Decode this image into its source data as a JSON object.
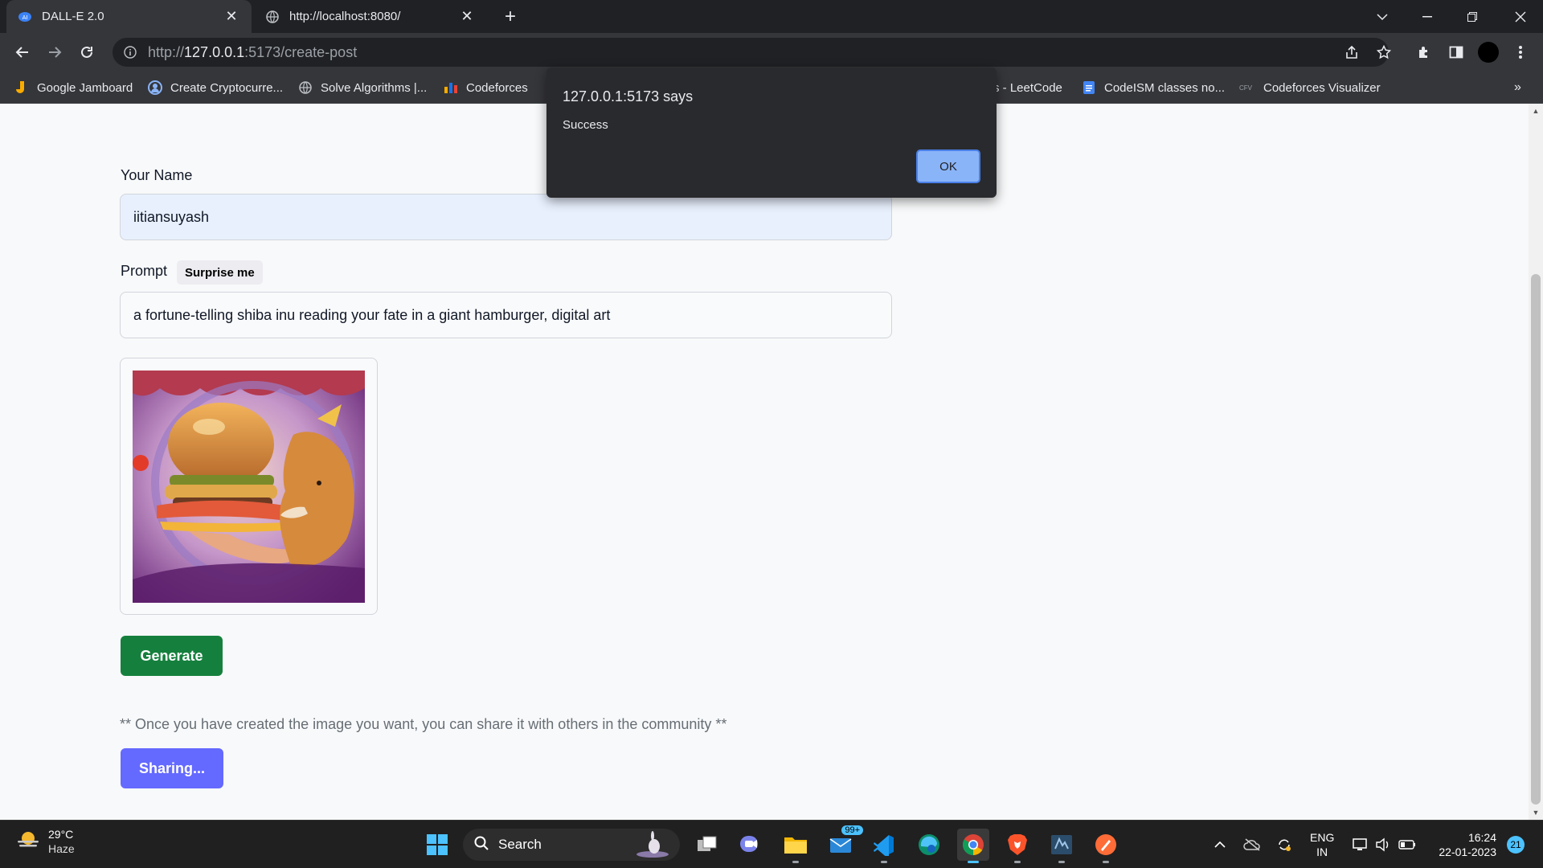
{
  "tabs": [
    {
      "title": "DALL-E 2.0",
      "active": true,
      "icon": "dalle-favicon"
    },
    {
      "title": "http://localhost:8080/",
      "active": false,
      "icon": "globe-icon"
    }
  ],
  "address_bar": {
    "scheme": "http://",
    "host": "127.0.0.1",
    "rest": ":5173/create-post"
  },
  "bookmarks": [
    {
      "label": "Google Jamboard",
      "icon": "jamboard-icon"
    },
    {
      "label": "Create Cryptocurre...",
      "icon": "crypto-icon"
    },
    {
      "label": "Solve Algorithms |...",
      "icon": "globe-icon"
    },
    {
      "label": "Codeforces",
      "icon": "codeforces-icon"
    },
    {
      "label": "s - LeetCode",
      "icon": ""
    },
    {
      "label": "CodeISM classes no...",
      "icon": "docs-icon"
    },
    {
      "label": "Codeforces Visualizer",
      "icon": "cfv-icon",
      "icon_text": "CFV"
    }
  ],
  "form": {
    "name_label": "Your Name",
    "name_value": "iitiansuyash",
    "prompt_label": "Prompt",
    "surprise_label": "Surprise me",
    "prompt_value": "a fortune-telling shiba inu reading your fate in a giant hamburger, digital art",
    "generate_label": "Generate",
    "hint": "** Once you have created the image you want, you can share it with others in the community **",
    "share_label": "Sharing..."
  },
  "alert": {
    "origin": "127.0.0.1:5173 says",
    "message": "Success",
    "ok_label": "OK"
  },
  "taskbar": {
    "temperature": "29°C",
    "weather": "Haze",
    "search_label": "Search",
    "mail_badge": "99+",
    "lang_line1": "ENG",
    "lang_line2": "IN",
    "time": "16:24",
    "date": "22-01-2023",
    "notification_count": "21"
  },
  "colors": {
    "generate_button": "#15803d",
    "share_button": "#6469ff",
    "alert_ok": "#8ab4f8"
  }
}
